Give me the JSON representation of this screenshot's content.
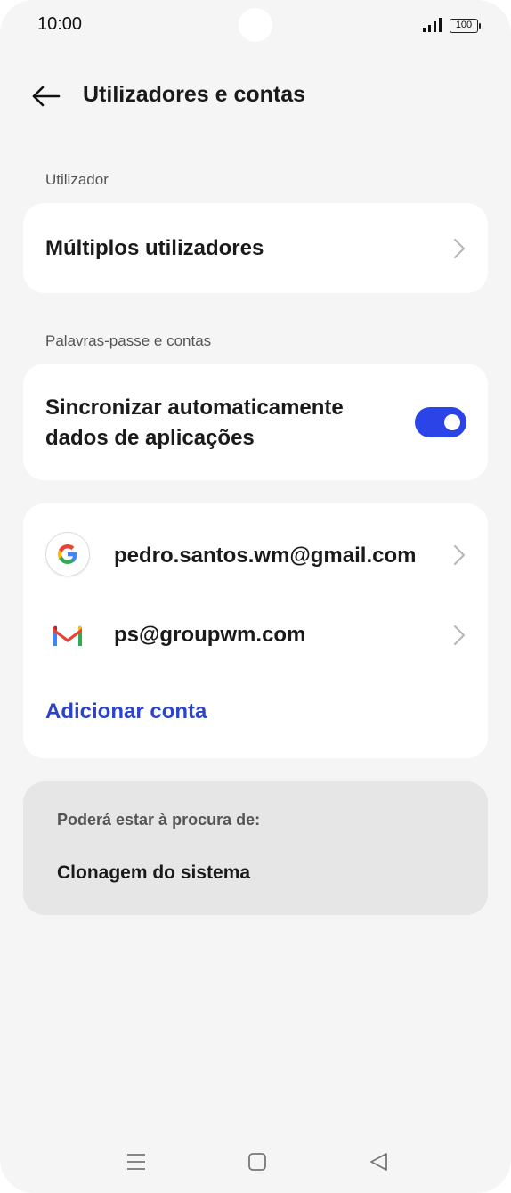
{
  "status_bar": {
    "time": "10:00",
    "battery": "100"
  },
  "header": {
    "title": "Utilizadores e contas"
  },
  "sections": {
    "user_label": "Utilizador",
    "accounts_label": "Palavras-passe e contas"
  },
  "multiple_users": {
    "label": "Múltiplos utilizadores"
  },
  "auto_sync": {
    "line1": "Sincronizar automaticamente",
    "line2": "dados de aplicações",
    "enabled": true
  },
  "accounts": [
    {
      "email": "pedro.santos.wm@gmail.com",
      "icon": "google-icon"
    },
    {
      "email": "ps@groupwm.com",
      "icon": "gmail-icon"
    }
  ],
  "add_account": {
    "label": "Adicionar conta"
  },
  "suggestions": {
    "label": "Poderá estar à procura de:",
    "item": "Clonagem do sistema"
  },
  "nav": {
    "icons": [
      "menu-icon",
      "home-icon",
      "back-icon"
    ]
  },
  "colors": {
    "accent": "#2b44e8",
    "link": "#2b44c9",
    "background": "#f5f5f5"
  }
}
